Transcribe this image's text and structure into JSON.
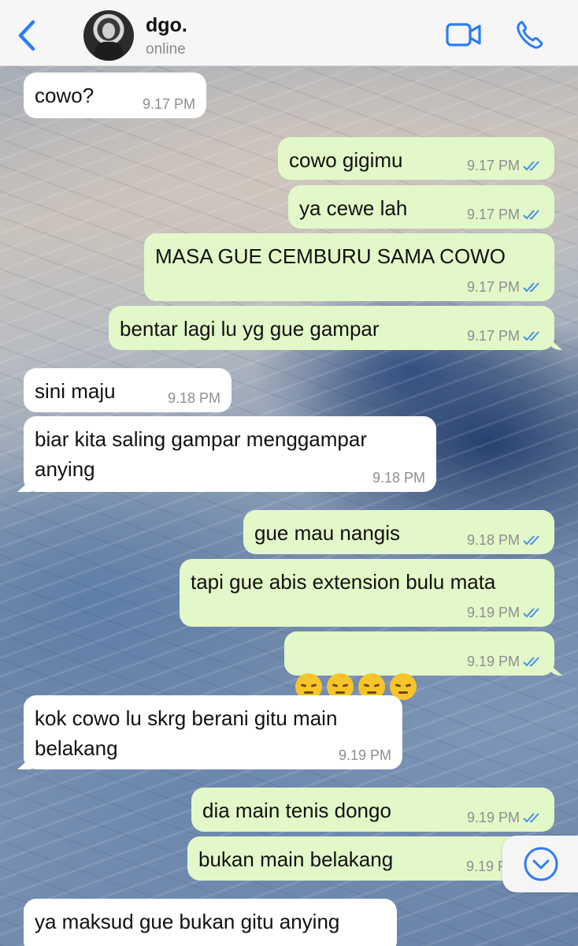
{
  "header": {
    "contact_name": "dgo.",
    "contact_status": "online",
    "accent_color": "#2b7cf6"
  },
  "messages": [
    {
      "dir": "in",
      "text": "cowo?",
      "time": "9.17 PM"
    },
    {
      "dir": "out",
      "text": "cowo gigimu",
      "time": "9.17 PM",
      "read": true
    },
    {
      "dir": "out",
      "text": "ya cewe lah",
      "time": "9.17 PM",
      "read": true
    },
    {
      "dir": "out",
      "text": "MASA GUE CEMBURU SAMA COWO",
      "time": "9.17 PM",
      "read": true
    },
    {
      "dir": "out",
      "text": "bentar lagi lu yg gue gampar",
      "time": "9.17 PM",
      "read": true
    },
    {
      "dir": "in",
      "text": "sini maju",
      "time": "9.18 PM"
    },
    {
      "dir": "in",
      "text": "biar kita saling gampar menggampar\nanying",
      "time": "9.18 PM"
    },
    {
      "dir": "out",
      "text": "gue mau nangis",
      "time": "9.18 PM",
      "read": true
    },
    {
      "dir": "out",
      "text": "tapi gue abis extension bulu mata",
      "time": "9.19 PM",
      "read": true
    },
    {
      "dir": "out",
      "emoji": "pensive-face",
      "emoji_count": 4,
      "time": "9.19 PM",
      "read": true
    },
    {
      "dir": "in",
      "text": "kok cowo lu skrg berani gitu main\nbelakang",
      "time": "9.19 PM"
    },
    {
      "dir": "out",
      "text": "dia main tenis dongo",
      "time": "9.19 PM",
      "read": true
    },
    {
      "dir": "out",
      "text": "bukan main belakang",
      "time": "9.19 P",
      "read": true
    },
    {
      "dir": "in",
      "text": "ya maksud gue bukan gitu anying"
    }
  ],
  "icons": {
    "back": "chevron-left-icon",
    "video": "video-camera-icon",
    "call": "phone-icon",
    "scroll": "chevron-down-circle-icon",
    "read": "double-check-icon"
  }
}
